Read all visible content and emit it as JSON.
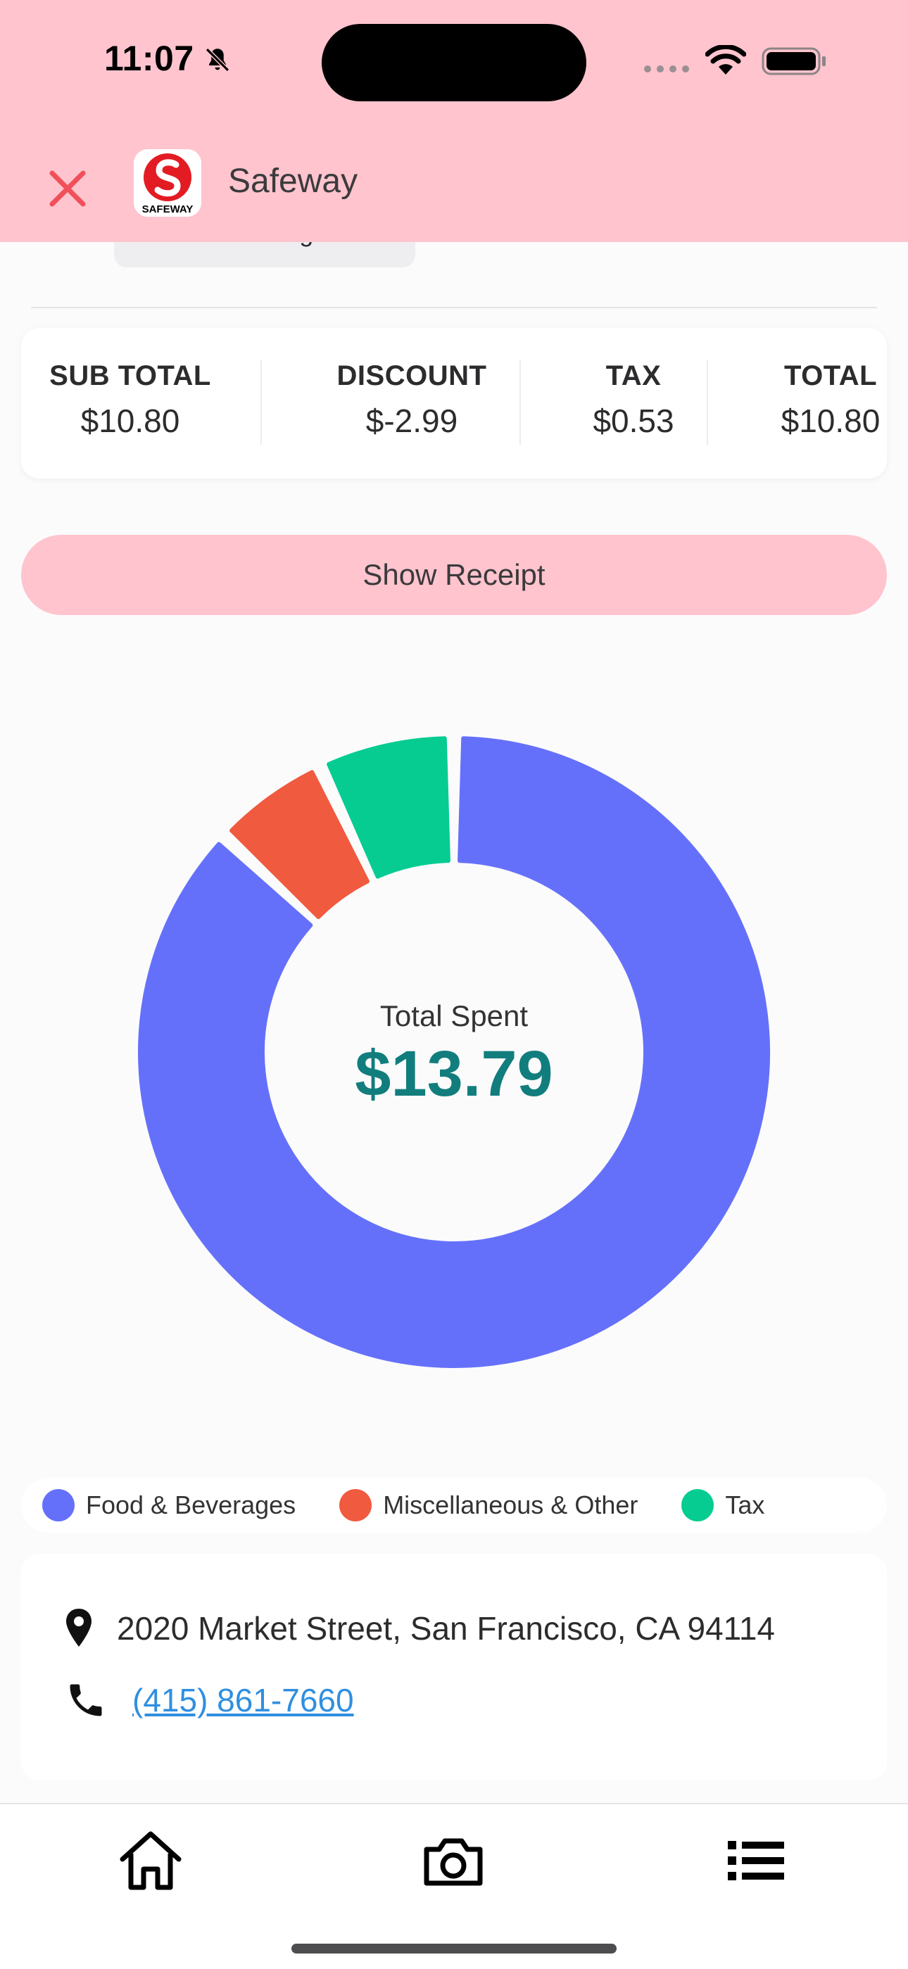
{
  "status_bar": {
    "time": "11:07"
  },
  "header": {
    "store_name": "Safeway",
    "logo_text": "SAFEWAY"
  },
  "previous_item": {
    "label": "Reusable Bag Fees"
  },
  "totals": [
    {
      "label": "SUB TOTAL",
      "value": "$10.80"
    },
    {
      "label": "DISCOUNT",
      "value": "$-2.99"
    },
    {
      "label": "TAX",
      "value": "$0.53"
    },
    {
      "label": "TOTAL",
      "value": "$10.80"
    }
  ],
  "receipt_button": {
    "label": "Show Receipt"
  },
  "chart": {
    "center_label": "Total Spent",
    "center_value": "$13.79"
  },
  "chart_data": {
    "type": "pie",
    "variant": "donut",
    "categories": [
      "Food & Beverages",
      "Miscellaneous & Other",
      "Tax"
    ],
    "values": [
      87,
      6,
      7
    ],
    "colors": [
      "#6570fa",
      "#f05a3f",
      "#06cc92"
    ],
    "title": "Total Spent",
    "legend_position": "bottom"
  },
  "legend": [
    {
      "label": "Food & Beverages",
      "color": "#6570fa"
    },
    {
      "label": "Miscellaneous & Other",
      "color": "#f05a3f"
    },
    {
      "label": "Tax",
      "color": "#06cc92"
    }
  ],
  "store_info": {
    "address": "2020 Market Street, San Francisco, CA 94114",
    "phone": "(415) 861-7660"
  },
  "tabs": [
    {
      "icon": "home-icon"
    },
    {
      "icon": "camera-icon"
    },
    {
      "icon": "list-icon"
    }
  ],
  "colors": {
    "header_bg": "#ffc4ce",
    "accent_teal": "#127d7d",
    "link": "#2f8fe0",
    "close": "#f0505a"
  }
}
